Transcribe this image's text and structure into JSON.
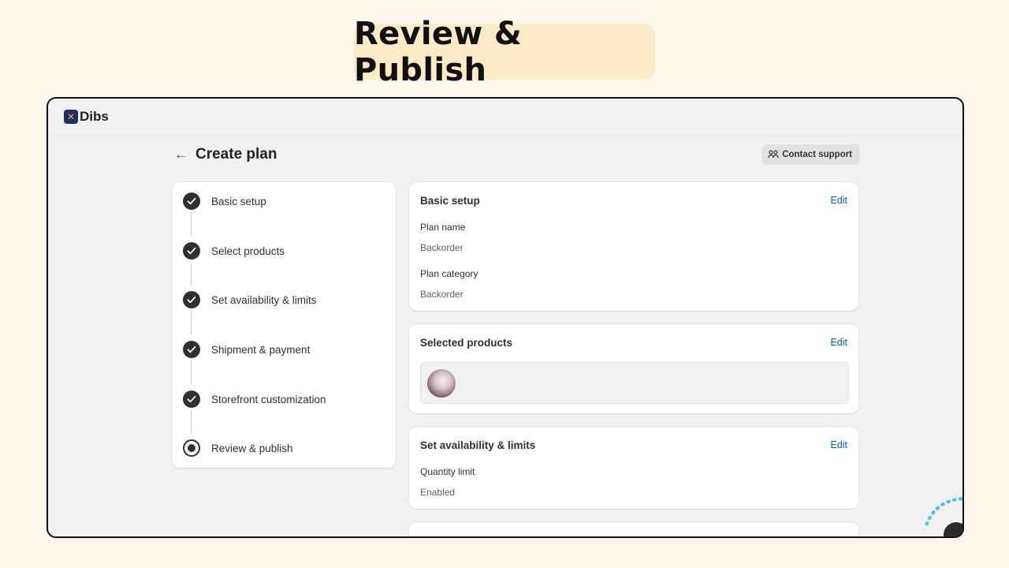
{
  "hero": {
    "title": "Review & Publish"
  },
  "app": {
    "logo_text": "Dibs"
  },
  "header": {
    "back_glyph": "←",
    "title": "Create plan",
    "support_label": "Contact support"
  },
  "steps": [
    {
      "label": "Basic setup",
      "state": "done"
    },
    {
      "label": "Select products",
      "state": "done"
    },
    {
      "label": "Set availability & limits",
      "state": "done"
    },
    {
      "label": "Shipment & payment",
      "state": "done"
    },
    {
      "label": "Storefront customization",
      "state": "done"
    },
    {
      "label": "Review & publish",
      "state": "current"
    }
  ],
  "cards": {
    "basic": {
      "title": "Basic setup",
      "edit": "Edit",
      "plan_name_label": "Plan name",
      "plan_name_value": "Backorder",
      "plan_category_label": "Plan category",
      "plan_category_value": "Backorder"
    },
    "products": {
      "title": "Selected products",
      "edit": "Edit"
    },
    "availability": {
      "title": "Set availability & limits",
      "edit": "Edit",
      "quantity_limit_label": "Quantity limit",
      "quantity_limit_value": "Enabled"
    }
  },
  "colors": {
    "accent_link": "#005bd3",
    "hero_bg": "#fdebc8",
    "page_bg": "#fef8ec"
  }
}
